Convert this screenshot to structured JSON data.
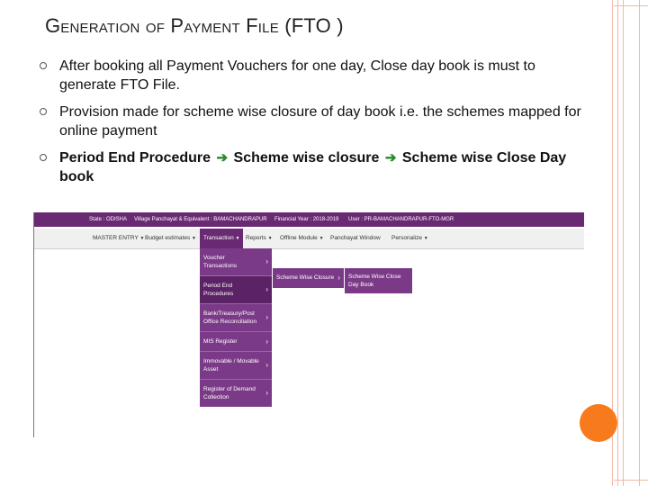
{
  "title": "Generation of Payment File (FTO )",
  "bullets": [
    {
      "text": "After booking all Payment Vouchers for one day, Close day book  is must to generate FTO File."
    },
    {
      "text": "Provision made for scheme wise closure of day book i.e. the schemes mapped for online payment"
    },
    {
      "parts": [
        "Period End Procedure",
        "Scheme wise closure",
        "Scheme wise Close Day book"
      ]
    }
  ],
  "screenshot": {
    "status": {
      "state": "State : ODISHA",
      "panchayat": "Village Panchayat & Equivalent : BAMACHANDRAPUR",
      "year": "Financial Year : 2018-2019",
      "user": "User : PR-BAMACHANDRAPUR-FTO-MGR"
    },
    "menu": [
      "MASTER ENTRY",
      "Budget estimates",
      "Transaction",
      "Reports",
      "Offline Module",
      "Panchayat Window",
      "Personalize"
    ],
    "dropdown": [
      "Voucher Transactions",
      "Period End Procedures",
      "Bank/Treasury/Post Office Reconciliation",
      "MIS Register",
      "Immovable / Movable Asset",
      "Register of Demand Collection"
    ],
    "submenu1": "Scheme Wise Closure",
    "submenu2": "Scheme Wise Close Day Book"
  },
  "colors": {
    "accent": "#6a2a73",
    "orange": "#f77b1c",
    "arrow": "#2a8a2a"
  }
}
